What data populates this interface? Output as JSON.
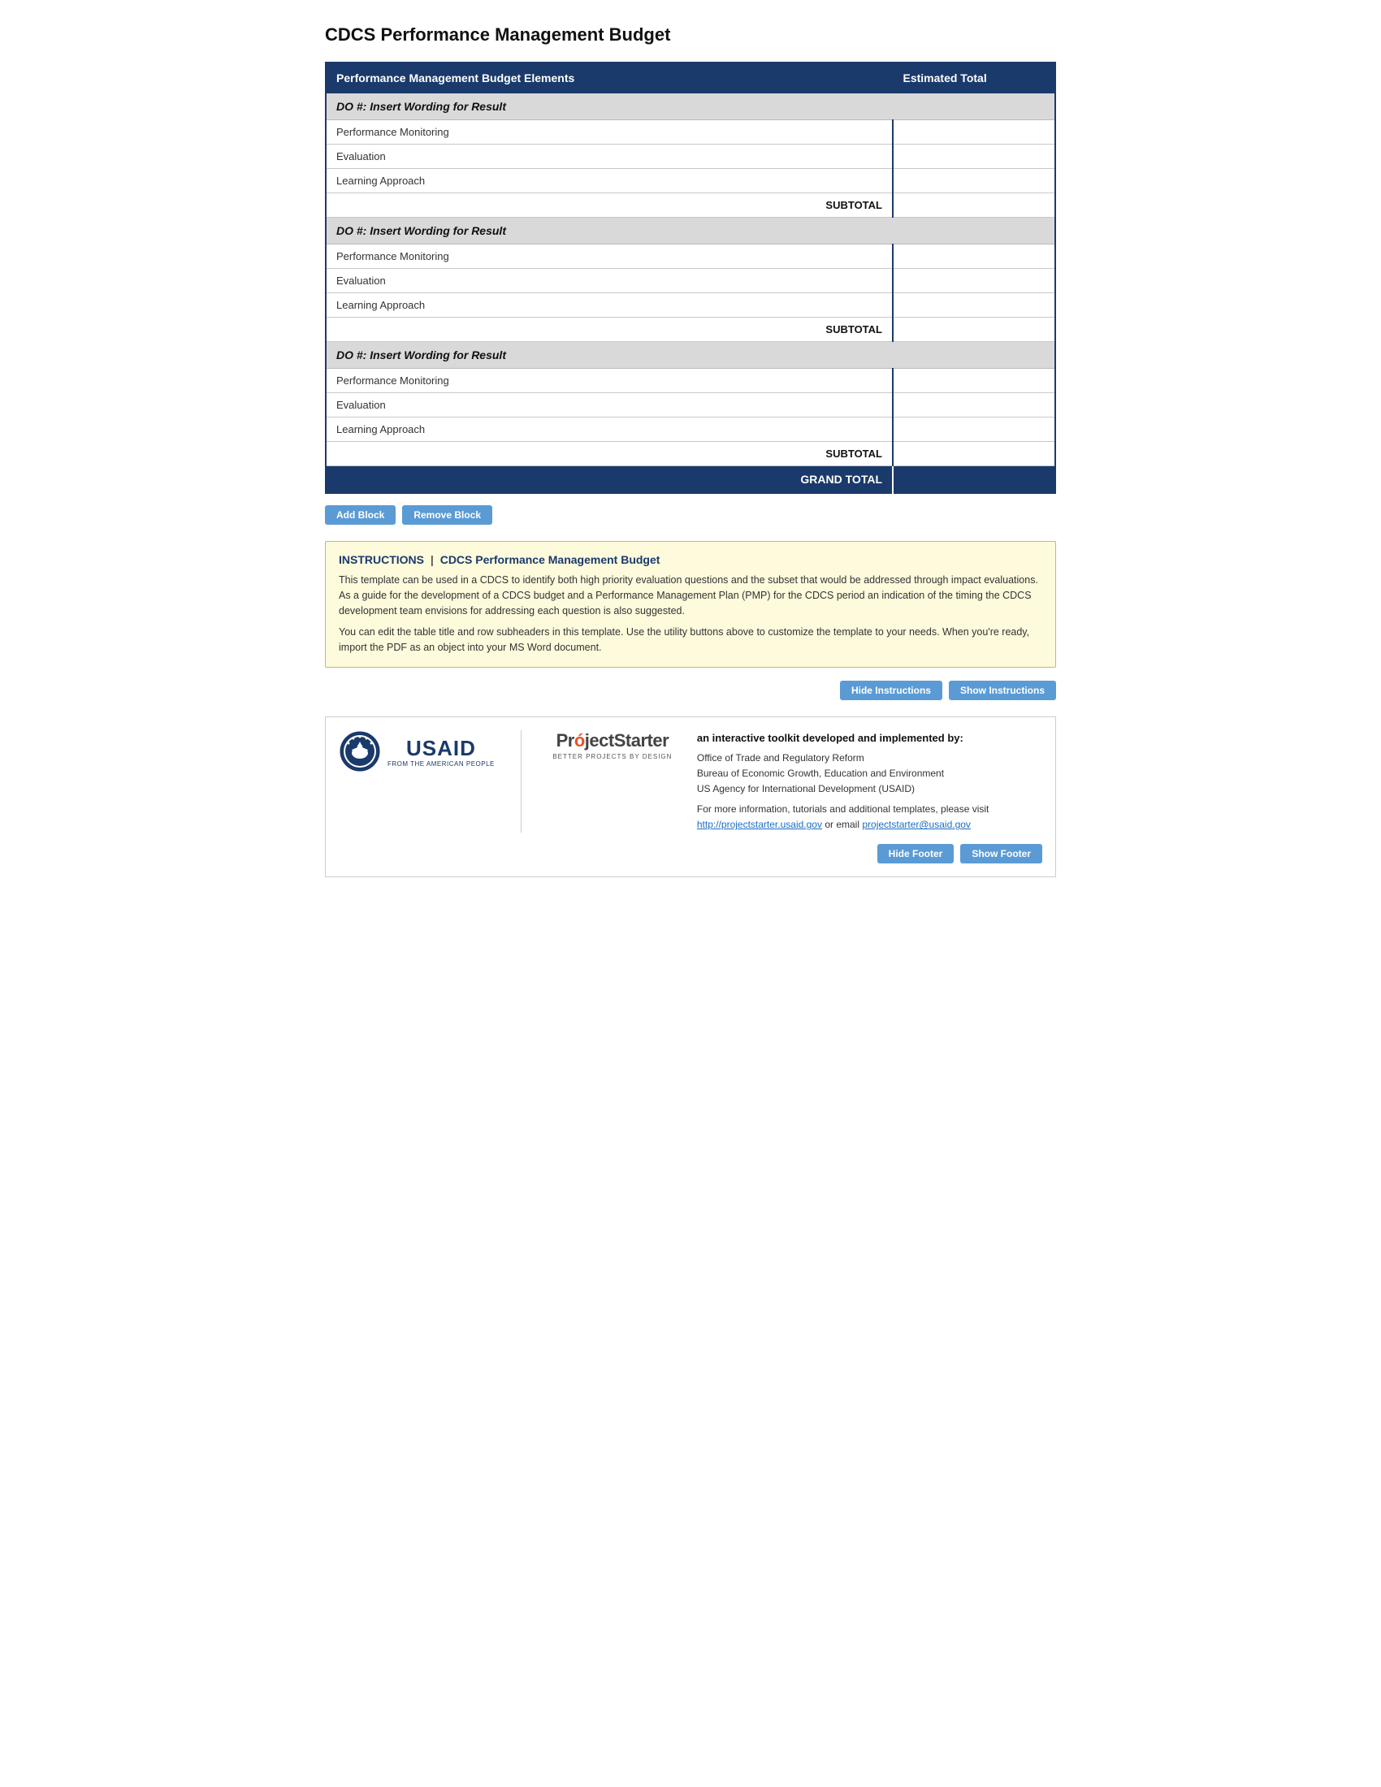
{
  "page": {
    "title": "CDCS Performance Management Budget"
  },
  "table": {
    "headers": {
      "elements": "Performance Management Budget Elements",
      "total": "Estimated Total"
    },
    "blocks": [
      {
        "header": "DO #: Insert Wording for Result",
        "rows": [
          {
            "label": "Performance Monitoring",
            "value": ""
          },
          {
            "label": "Evaluation",
            "value": ""
          },
          {
            "label": "Learning Approach",
            "value": ""
          }
        ],
        "subtotal_label": "SUBTOTAL",
        "subtotal_value": ""
      },
      {
        "header": "DO #: Insert Wording for Result",
        "rows": [
          {
            "label": "Performance Monitoring",
            "value": ""
          },
          {
            "label": "Evaluation",
            "value": ""
          },
          {
            "label": "Learning Approach",
            "value": ""
          }
        ],
        "subtotal_label": "SUBTOTAL",
        "subtotal_value": ""
      },
      {
        "header": "DO #: Insert Wording for Result",
        "rows": [
          {
            "label": "Performance Monitoring",
            "value": ""
          },
          {
            "label": "Evaluation",
            "value": ""
          },
          {
            "label": "Learning Approach",
            "value": ""
          }
        ],
        "subtotal_label": "SUBTOTAL",
        "subtotal_value": ""
      }
    ],
    "grand_total_label": "GRAND TOTAL",
    "grand_total_value": ""
  },
  "buttons": {
    "add_block": "Add Block",
    "remove_block": "Remove Block",
    "hide_instructions": "Hide Instructions",
    "show_instructions": "Show Instructions",
    "hide_footer": "Hide Footer",
    "show_footer": "Show Footer"
  },
  "instructions": {
    "label": "INSTRUCTIONS",
    "separator": "|",
    "doc_title": "CDCS Performance Management Budget",
    "paragraph1": "This template can be used in a CDCS to identify both high priority evaluation questions and the subset that would be addressed through impact evaluations. As a guide for the development of a CDCS budget and a Performance Management Plan (PMP) for the CDCS period an indication of the timing the CDCS development team envisions for addressing each question is also suggested.",
    "paragraph2": "You can edit the table title and row subheaders in this template. Use the utility buttons above to customize the template to your needs. When you're ready, import the PDF as an object into your MS Word document."
  },
  "footer": {
    "usaid_brand": "USAID",
    "usaid_from": "FROM THE AMERICAN PEOPLE",
    "ps_name_pre": "Pr",
    "ps_dot": "ó",
    "ps_name_post": "jectStarter",
    "ps_tagline": "BETTER PROJECTS BY DESIGN",
    "developed_by": "an interactive toolkit developed and implemented by:",
    "org1": "Office of Trade and Regulatory Reform",
    "org2": "Bureau of Economic Growth, Education and Environment",
    "org3": "US Agency for International Development (USAID)",
    "more_info": "For more information, tutorials and additional templates, please visit",
    "website_url": "http://projectstarter.usaid.gov",
    "or_email": "or email",
    "email": "projectstarter@usaid.gov"
  }
}
